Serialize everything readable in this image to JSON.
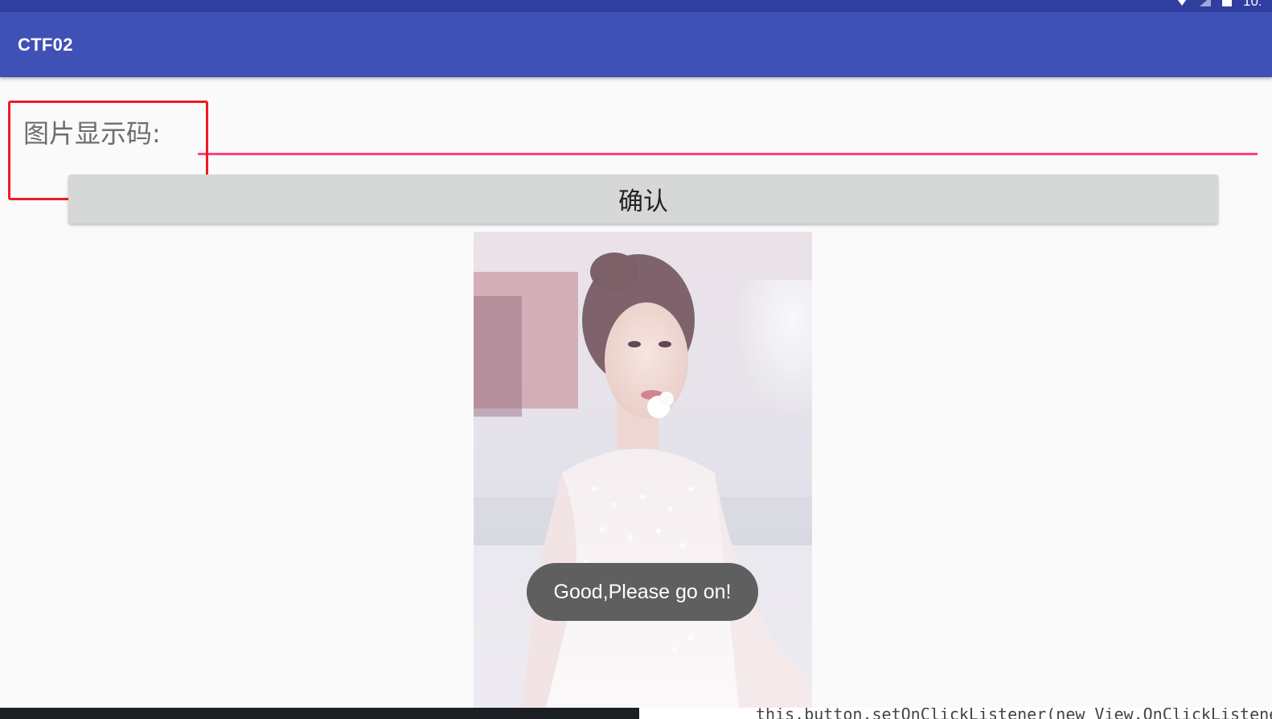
{
  "status_bar": {
    "icons": [
      "wifi-icon",
      "signal-icon",
      "battery-icon"
    ],
    "clock": "10:"
  },
  "app_bar": {
    "title": "CTF02",
    "color": "#3f51b5",
    "status_color": "#303f9f"
  },
  "form": {
    "label": "图片显示码:",
    "input_value": "",
    "input_underline_color": "#ff4081",
    "highlight_color": "#ee1b24"
  },
  "confirm_button": {
    "label": "确认"
  },
  "photo": {
    "description": "portrait-photo"
  },
  "toast": {
    "message": "Good,Please go on!"
  },
  "background_window": {
    "code_snippet": "this.button.setOnClickListener(new View.OnClickListener"
  }
}
